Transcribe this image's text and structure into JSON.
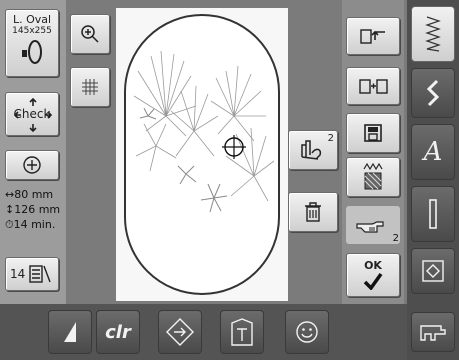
{
  "hoop": {
    "name": "L. Oval",
    "size": "145x255"
  },
  "left_buttons": {
    "check_label": "Check",
    "color_count": "14"
  },
  "info": {
    "width": "↔80 mm",
    "height": "↕126 mm",
    "time": "⏱14 min."
  },
  "right_column": {
    "move_badge": "2",
    "stitch_badge": "2",
    "ok_label": "OK"
  },
  "bottom": {
    "clr_label": "clr"
  },
  "far_right": {
    "a_label": "A"
  },
  "icons": [
    "zoom-in-icon",
    "grid-icon",
    "check-icon",
    "center-icon",
    "color-list-icon",
    "split-move-icon",
    "delete-icon",
    "rotate-back-icon",
    "combine-icon",
    "save-icon",
    "stitch-density-icon",
    "hand-pointer-icon",
    "ok-check-icon",
    "contrast-icon",
    "clear-icon",
    "rotate-icon",
    "book-icon",
    "smiley-icon",
    "stitch-zigzag-icon",
    "stitch-s-icon",
    "alphabet-icon",
    "bar-icon",
    "frame-icon",
    "embroidery-machine-icon"
  ]
}
